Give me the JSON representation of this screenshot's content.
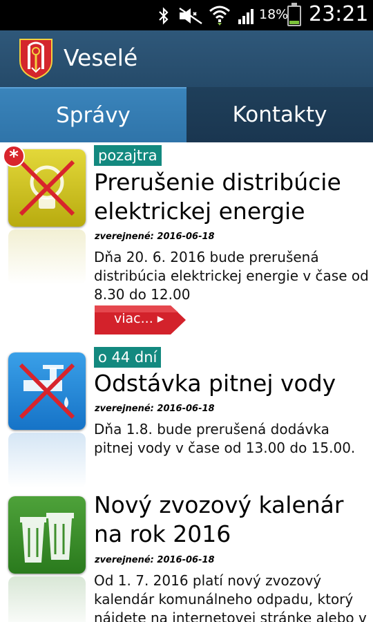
{
  "status_bar": {
    "icons": [
      "bluetooth-icon",
      "mute-icon",
      "wifi-icon",
      "signal-icon"
    ],
    "battery_percent": "18%",
    "time": "23:21"
  },
  "app": {
    "title": "Veselé",
    "logo": "crest-icon"
  },
  "tabs": [
    {
      "label": "Správy",
      "active": true
    },
    {
      "label": "Kontakty",
      "active": false
    }
  ],
  "news": [
    {
      "badge": "pozajtra",
      "title": "Prerušenie distribúcie elektrickej energie",
      "published": "zverejnené: 2016-06-18",
      "body": "Dňa 20. 6. 2016 bude prerušená distribúcia elektrickej energie v čase od 8.30 do 12.00",
      "more_label": "viac... ▸",
      "icon": "no-electricity-icon",
      "is_new": true,
      "new_mark": "*"
    },
    {
      "badge": "o 44 dní",
      "title": "Odstávka pitnej vody",
      "published": "zverejnené: 2016-06-18",
      "body": "Dňa 1.8. bude prerušená dodávka pitnej vody v čase od 13.00 do 15.00.",
      "icon": "no-water-icon"
    },
    {
      "title": "Nový zvozový kalenár na rok 2016",
      "published": "zverejnené: 2016-06-18",
      "body": "Od 1. 7. 2016 platí nový zvozový kalendár komunálneho odpadu, ktorý nájdete na internetovej stránke alebo v",
      "icon": "waste-bins-icon"
    }
  ],
  "colors": {
    "action_bar": "#2f587a",
    "tab_active": "#3a84bb",
    "tab_inactive": "#1f3f5a",
    "badge": "#13897f",
    "more_button": "#d3222b"
  }
}
